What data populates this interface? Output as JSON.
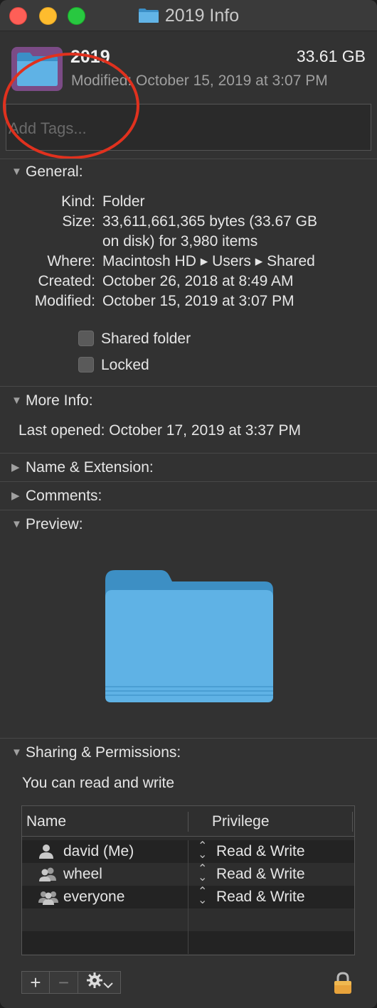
{
  "window": {
    "title": "2019 Info"
  },
  "header": {
    "name": "2019",
    "size": "33.61 GB",
    "modified": "Modified: October 15, 2019 at 3:07 PM",
    "tags_placeholder": "Add Tags..."
  },
  "general": {
    "title": "General:",
    "rows": [
      {
        "key": "Kind:",
        "value": "Folder"
      },
      {
        "key": "Size:",
        "value": "33,611,661,365 bytes (33.67 GB"
      },
      {
        "key": "",
        "value": "on disk) for 3,980 items"
      },
      {
        "key": "Where:",
        "value": "Macintosh HD ▸ Users ▸ Shared"
      },
      {
        "key": "Created:",
        "value": "October 26, 2018 at 8:49 AM"
      },
      {
        "key": "Modified:",
        "value": "October 15, 2019 at 3:07 PM"
      }
    ],
    "shared_folder_label": "Shared folder",
    "shared_folder_checked": false,
    "locked_label": "Locked",
    "locked_checked": false
  },
  "more_info": {
    "title": "More Info:",
    "last_opened": "Last opened: October 17, 2019 at 3:37 PM"
  },
  "name_extension": {
    "title": "Name & Extension:"
  },
  "comments": {
    "title": "Comments:"
  },
  "preview": {
    "title": "Preview:"
  },
  "sharing": {
    "title": "Sharing & Permissions:",
    "summary": "You can read and write",
    "col_name": "Name",
    "col_privilege": "Privilege",
    "rows": [
      {
        "name": "david (Me)",
        "privilege": "Read & Write",
        "icon": "person-icon"
      },
      {
        "name": "wheel",
        "privilege": "Read & Write",
        "icon": "group-icon"
      },
      {
        "name": "everyone",
        "privilege": "Read & Write",
        "icon": "everyone-icon"
      }
    ],
    "add_label": "+",
    "remove_label": "−",
    "action_icon": "gear-icon",
    "lock_icon": "lock-icon"
  },
  "colors": {
    "folder_blue": "#5aaee0",
    "annotation_red": "#e0311e",
    "lock_orange": "#e8a33b"
  }
}
